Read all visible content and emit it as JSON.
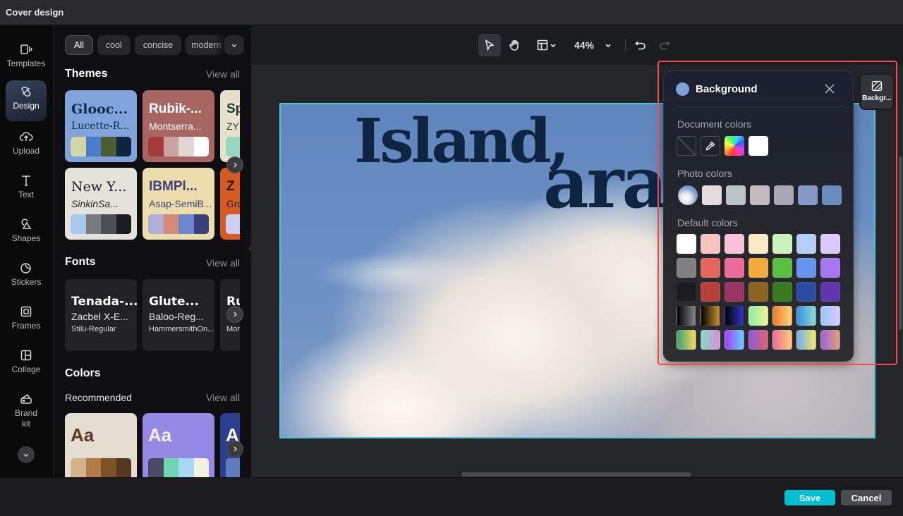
{
  "window": {
    "title": "Cover design"
  },
  "rail": {
    "items": [
      {
        "label": "Templates",
        "icon": "templates-icon"
      },
      {
        "label": "Design",
        "icon": "design-icon",
        "active": true
      },
      {
        "label": "Upload",
        "icon": "upload-icon"
      },
      {
        "label": "Text",
        "icon": "text-icon"
      },
      {
        "label": "Shapes",
        "icon": "shapes-icon"
      },
      {
        "label": "Stickers",
        "icon": "stickers-icon"
      },
      {
        "label": "Frames",
        "icon": "frames-icon"
      },
      {
        "label": "Collage",
        "icon": "collage-icon"
      },
      {
        "label": "Brand kit",
        "icon": "brand-kit-icon"
      }
    ],
    "more_icon": "chevron-down-icon"
  },
  "panel": {
    "chips": [
      "All",
      "cool",
      "concise",
      "modern"
    ],
    "themes": {
      "title": "Themes",
      "view_all": "View all",
      "cards": [
        {
          "t1": "Glooc...",
          "t2": "Lucette-R...",
          "bg": "#7fa3da",
          "fg": "#0e2a44",
          "palette": [
            "#cfd6a8",
            "#4a7ccb",
            "#4b5e30",
            "#0c2642"
          ]
        },
        {
          "t1": "Rubik-...",
          "t2": "Montserra...",
          "bg": "#a86663",
          "fg": "#ffffff",
          "palette": [
            "#a33c3a",
            "#c9a4a2",
            "#e2d6d5",
            "#ffffff"
          ]
        },
        {
          "t1": "Sp",
          "t2": "ZY",
          "bg": "#e9e1cc",
          "fg": "#1f3b36",
          "palette": [
            "#96d8bf"
          ]
        },
        {
          "t1": "New Y...",
          "t2": "SinkinSa...",
          "bg": "#e5e2dc",
          "fg": "#222222",
          "palette": [
            "#a8c8ec",
            "#7a7b7d",
            "#4c4f53",
            "#1c1d20"
          ]
        },
        {
          "t1": "IBMPl...",
          "t2": "Asap-SemiB...",
          "bg": "#eddcac",
          "fg": "#3b3f7a",
          "palette": [
            "#aeb0d8",
            "#d58a77",
            "#6b88cf",
            "#3b3f7a"
          ]
        },
        {
          "t1": "Z",
          "t2": "Gro",
          "bg": "#d65b23",
          "fg": "#2a1a12",
          "palette": [
            "#cdd0f2"
          ]
        }
      ]
    },
    "fonts": {
      "title": "Fonts",
      "view_all": "View all",
      "cards": [
        {
          "f1": "Tenada-...",
          "f2": "Zacbel X-E...",
          "f3": "Stilu-Regular"
        },
        {
          "f1": "Glute...",
          "f2": "Baloo-Reg...",
          "f3": "HammersmithOn..."
        },
        {
          "f1": "Ru",
          "f2": "",
          "f3": "Mor"
        }
      ]
    },
    "colors": {
      "title": "Colors",
      "recommended": "Recommended",
      "view_all": "View all",
      "cards": [
        {
          "aa": "Aa",
          "bg": "#e6ddd2",
          "fg": "#5a3a22",
          "palette": [
            "#d6b38c",
            "#b17c4a",
            "#7d5129",
            "#563822"
          ]
        },
        {
          "aa": "Aa",
          "bg": "#9589e5",
          "fg": "#f4f0e0",
          "palette": [
            "#4a4a66",
            "#70d6b2",
            "#a6d8f8",
            "#f4f1e1"
          ]
        },
        {
          "aa": "A",
          "bg": "#2b3f8e",
          "fg": "#ffffff",
          "palette": [
            "#5f7bc0"
          ]
        }
      ]
    }
  },
  "toolbar": {
    "select_icon": "pointer-icon",
    "hand_icon": "hand-icon",
    "layout_icon": "layout-icon",
    "zoom": "44%",
    "undo_icon": "undo-icon",
    "redo_icon": "redo-icon"
  },
  "canvas": {
    "heading_line1": "Island,",
    "heading_line2": "ara"
  },
  "background_panel": {
    "title": "Background",
    "current_color": "#7ea1da",
    "document_colors_label": "Document colors",
    "document_colors": [
      "none",
      "eyedropper",
      "rainbow",
      "#ffffff"
    ],
    "photo_colors_label": "Photo colors",
    "photo_colors": [
      "photo",
      "#e3dcda",
      "#bcc2ca",
      "#c4b9bd",
      "#a6a8b3",
      "#8599c6",
      "#6a8cbc"
    ],
    "default_colors_label": "Default colors",
    "default_colors": [
      "#ffffff",
      "#f7c4c2",
      "#f8c3d8",
      "#fbe9c3",
      "#c9f3bd",
      "#b5cdf9",
      "#dcc9fb",
      "#808080",
      "#e4665e",
      "#ec6c9c",
      "#f0ab3c",
      "#5cbf41",
      "#6695ef",
      "#a777f3",
      "#1b1a1f",
      "#b6413a",
      "#9a3460",
      "#8b6221",
      "#377a20",
      "#2a4ca3",
      "#6334b0",
      "linear-gradient(90deg,#000,#888)",
      "linear-gradient(90deg,#000,#c9952f)",
      "linear-gradient(90deg,#000,#3335c9)",
      "linear-gradient(90deg,#8ff0a4,#f0f09a)",
      "linear-gradient(90deg,#ee7a30,#f8d87a)",
      "linear-gradient(90deg,#3a8ee6,#8cdcc7)",
      "linear-gradient(90deg,#9cc6fc,#dbcaf8)",
      "linear-gradient(90deg,#3fa07a,#f4dc55)",
      "linear-gradient(90deg,#7ee0c0,#e08ae0)",
      "linear-gradient(90deg,#b238ff,#5cd4ff)",
      "linear-gradient(90deg,#8a5ce0,#e0646a)",
      "linear-gradient(90deg,#f06aa0,#f8d070)",
      "linear-gradient(90deg,#6ab0f8,#f8e860)",
      "linear-gradient(90deg,#9a64e0,#e0a070)"
    ],
    "close_icon": "close-icon"
  },
  "background_tab": {
    "label": "Backgr..."
  },
  "footer": {
    "save": "Save",
    "cancel": "Cancel"
  }
}
